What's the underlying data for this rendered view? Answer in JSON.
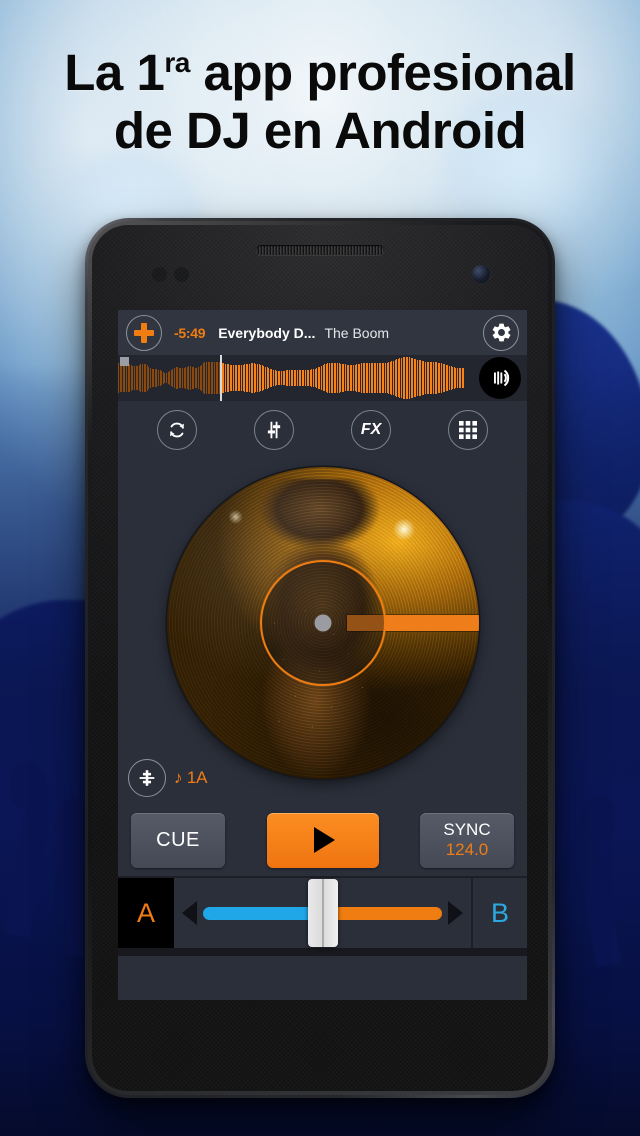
{
  "headline": {
    "line1_pre": "La 1",
    "line1_sup": "ra",
    "line1_post": " app profesional",
    "line2": "de DJ en Android"
  },
  "colors": {
    "accent_orange": "#f07d12",
    "play_orange": "#fb8e22",
    "deck_b_blue": "#2ba9e0",
    "rail_blue": "#1fa7e8",
    "screen_bg": "#2b2f3a",
    "topbar_bg": "#31353f",
    "wave_bg": "#23262f",
    "button_grey": "#565b67"
  },
  "app": {
    "topbar": {
      "add_icon": "plus-icon",
      "time_remaining": "-5:49",
      "track_title": "Everybody D...",
      "track_artist": "The Boom",
      "settings_icon": "gear-icon"
    },
    "waveform": {
      "vinyl_mode_icon": "vinyl-mode-icon",
      "playhead_percent": 25,
      "flag_marker": "cue-marker"
    },
    "icon_row": [
      {
        "name": "loop-icon",
        "label": ""
      },
      {
        "name": "eq-sliders-icon",
        "label": ""
      },
      {
        "name": "fx-icon",
        "label": "FX"
      },
      {
        "name": "grid-pads-icon",
        "label": ""
      }
    ],
    "deck": {
      "jog_wheel": "jog-wheel",
      "tonearm_indicator": "position-marker",
      "key_icon": "key-lock-icon",
      "key_value": "♪ 1A"
    },
    "transport": {
      "cue_label": "CUE",
      "play_icon": "play-icon",
      "sync_label": "SYNC",
      "bpm_value": "124.0"
    },
    "crossfader": {
      "deck_a_label": "A",
      "deck_b_label": "B",
      "left_arrow_icon": "arrow-left-icon",
      "right_arrow_icon": "arrow-right-icon",
      "position_percent": 50
    }
  }
}
